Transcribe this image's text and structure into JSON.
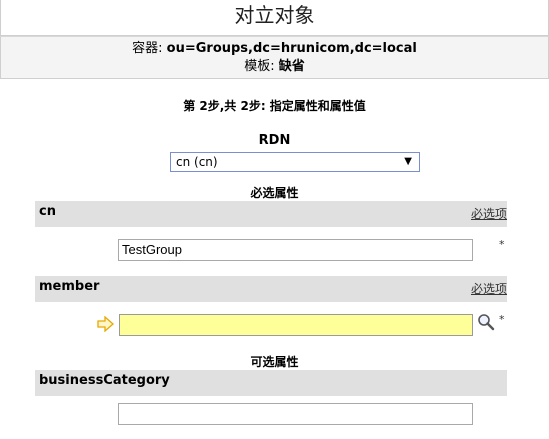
{
  "title": "对立对象",
  "info": {
    "container_label": "容器:",
    "container_value": "ou=Groups,dc=hrunicom,dc=local",
    "template_label": "模板:",
    "template_value": "缺省"
  },
  "step_text": "第 2步,共 2步: 指定属性和属性值",
  "rdn": {
    "label": "RDN",
    "selected": "cn (cn)"
  },
  "required_section_title": "必选属性",
  "optional_section_title": "可选属性",
  "attributes": {
    "cn": {
      "name": "cn",
      "req_label": "必选项",
      "value": "TestGroup",
      "star": "*"
    },
    "member": {
      "name": "member",
      "req_label": "必选项",
      "value": "",
      "star": "*"
    },
    "businessCategory": {
      "name": "businessCategory",
      "value": ""
    }
  },
  "colors": {
    "member_field_bg": "#ffff99",
    "attr_header_bg": "#e0e0e0",
    "select_border": "#7a8fd0",
    "arrow_icon": "#e8a800"
  }
}
